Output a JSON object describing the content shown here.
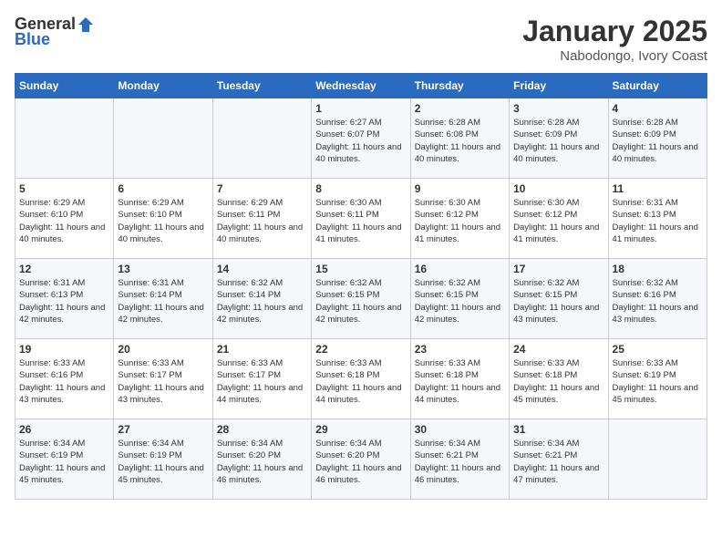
{
  "logo": {
    "general": "General",
    "blue": "Blue"
  },
  "title": "January 2025",
  "subtitle": "Nabodongo, Ivory Coast",
  "days_of_week": [
    "Sunday",
    "Monday",
    "Tuesday",
    "Wednesday",
    "Thursday",
    "Friday",
    "Saturday"
  ],
  "weeks": [
    [
      {
        "day": "",
        "sunrise": "",
        "sunset": "",
        "daylight": ""
      },
      {
        "day": "",
        "sunrise": "",
        "sunset": "",
        "daylight": ""
      },
      {
        "day": "",
        "sunrise": "",
        "sunset": "",
        "daylight": ""
      },
      {
        "day": "1",
        "sunrise": "Sunrise: 6:27 AM",
        "sunset": "Sunset: 6:07 PM",
        "daylight": "Daylight: 11 hours and 40 minutes."
      },
      {
        "day": "2",
        "sunrise": "Sunrise: 6:28 AM",
        "sunset": "Sunset: 6:08 PM",
        "daylight": "Daylight: 11 hours and 40 minutes."
      },
      {
        "day": "3",
        "sunrise": "Sunrise: 6:28 AM",
        "sunset": "Sunset: 6:09 PM",
        "daylight": "Daylight: 11 hours and 40 minutes."
      },
      {
        "day": "4",
        "sunrise": "Sunrise: 6:28 AM",
        "sunset": "Sunset: 6:09 PM",
        "daylight": "Daylight: 11 hours and 40 minutes."
      }
    ],
    [
      {
        "day": "5",
        "sunrise": "Sunrise: 6:29 AM",
        "sunset": "Sunset: 6:10 PM",
        "daylight": "Daylight: 11 hours and 40 minutes."
      },
      {
        "day": "6",
        "sunrise": "Sunrise: 6:29 AM",
        "sunset": "Sunset: 6:10 PM",
        "daylight": "Daylight: 11 hours and 40 minutes."
      },
      {
        "day": "7",
        "sunrise": "Sunrise: 6:29 AM",
        "sunset": "Sunset: 6:11 PM",
        "daylight": "Daylight: 11 hours and 40 minutes."
      },
      {
        "day": "8",
        "sunrise": "Sunrise: 6:30 AM",
        "sunset": "Sunset: 6:11 PM",
        "daylight": "Daylight: 11 hours and 41 minutes."
      },
      {
        "day": "9",
        "sunrise": "Sunrise: 6:30 AM",
        "sunset": "Sunset: 6:12 PM",
        "daylight": "Daylight: 11 hours and 41 minutes."
      },
      {
        "day": "10",
        "sunrise": "Sunrise: 6:30 AM",
        "sunset": "Sunset: 6:12 PM",
        "daylight": "Daylight: 11 hours and 41 minutes."
      },
      {
        "day": "11",
        "sunrise": "Sunrise: 6:31 AM",
        "sunset": "Sunset: 6:13 PM",
        "daylight": "Daylight: 11 hours and 41 minutes."
      }
    ],
    [
      {
        "day": "12",
        "sunrise": "Sunrise: 6:31 AM",
        "sunset": "Sunset: 6:13 PM",
        "daylight": "Daylight: 11 hours and 42 minutes."
      },
      {
        "day": "13",
        "sunrise": "Sunrise: 6:31 AM",
        "sunset": "Sunset: 6:14 PM",
        "daylight": "Daylight: 11 hours and 42 minutes."
      },
      {
        "day": "14",
        "sunrise": "Sunrise: 6:32 AM",
        "sunset": "Sunset: 6:14 PM",
        "daylight": "Daylight: 11 hours and 42 minutes."
      },
      {
        "day": "15",
        "sunrise": "Sunrise: 6:32 AM",
        "sunset": "Sunset: 6:15 PM",
        "daylight": "Daylight: 11 hours and 42 minutes."
      },
      {
        "day": "16",
        "sunrise": "Sunrise: 6:32 AM",
        "sunset": "Sunset: 6:15 PM",
        "daylight": "Daylight: 11 hours and 42 minutes."
      },
      {
        "day": "17",
        "sunrise": "Sunrise: 6:32 AM",
        "sunset": "Sunset: 6:15 PM",
        "daylight": "Daylight: 11 hours and 43 minutes."
      },
      {
        "day": "18",
        "sunrise": "Sunrise: 6:32 AM",
        "sunset": "Sunset: 6:16 PM",
        "daylight": "Daylight: 11 hours and 43 minutes."
      }
    ],
    [
      {
        "day": "19",
        "sunrise": "Sunrise: 6:33 AM",
        "sunset": "Sunset: 6:16 PM",
        "daylight": "Daylight: 11 hours and 43 minutes."
      },
      {
        "day": "20",
        "sunrise": "Sunrise: 6:33 AM",
        "sunset": "Sunset: 6:17 PM",
        "daylight": "Daylight: 11 hours and 43 minutes."
      },
      {
        "day": "21",
        "sunrise": "Sunrise: 6:33 AM",
        "sunset": "Sunset: 6:17 PM",
        "daylight": "Daylight: 11 hours and 44 minutes."
      },
      {
        "day": "22",
        "sunrise": "Sunrise: 6:33 AM",
        "sunset": "Sunset: 6:18 PM",
        "daylight": "Daylight: 11 hours and 44 minutes."
      },
      {
        "day": "23",
        "sunrise": "Sunrise: 6:33 AM",
        "sunset": "Sunset: 6:18 PM",
        "daylight": "Daylight: 11 hours and 44 minutes."
      },
      {
        "day": "24",
        "sunrise": "Sunrise: 6:33 AM",
        "sunset": "Sunset: 6:18 PM",
        "daylight": "Daylight: 11 hours and 45 minutes."
      },
      {
        "day": "25",
        "sunrise": "Sunrise: 6:33 AM",
        "sunset": "Sunset: 6:19 PM",
        "daylight": "Daylight: 11 hours and 45 minutes."
      }
    ],
    [
      {
        "day": "26",
        "sunrise": "Sunrise: 6:34 AM",
        "sunset": "Sunset: 6:19 PM",
        "daylight": "Daylight: 11 hours and 45 minutes."
      },
      {
        "day": "27",
        "sunrise": "Sunrise: 6:34 AM",
        "sunset": "Sunset: 6:19 PM",
        "daylight": "Daylight: 11 hours and 45 minutes."
      },
      {
        "day": "28",
        "sunrise": "Sunrise: 6:34 AM",
        "sunset": "Sunset: 6:20 PM",
        "daylight": "Daylight: 11 hours and 46 minutes."
      },
      {
        "day": "29",
        "sunrise": "Sunrise: 6:34 AM",
        "sunset": "Sunset: 6:20 PM",
        "daylight": "Daylight: 11 hours and 46 minutes."
      },
      {
        "day": "30",
        "sunrise": "Sunrise: 6:34 AM",
        "sunset": "Sunset: 6:21 PM",
        "daylight": "Daylight: 11 hours and 46 minutes."
      },
      {
        "day": "31",
        "sunrise": "Sunrise: 6:34 AM",
        "sunset": "Sunset: 6:21 PM",
        "daylight": "Daylight: 11 hours and 47 minutes."
      },
      {
        "day": "",
        "sunrise": "",
        "sunset": "",
        "daylight": ""
      }
    ]
  ]
}
